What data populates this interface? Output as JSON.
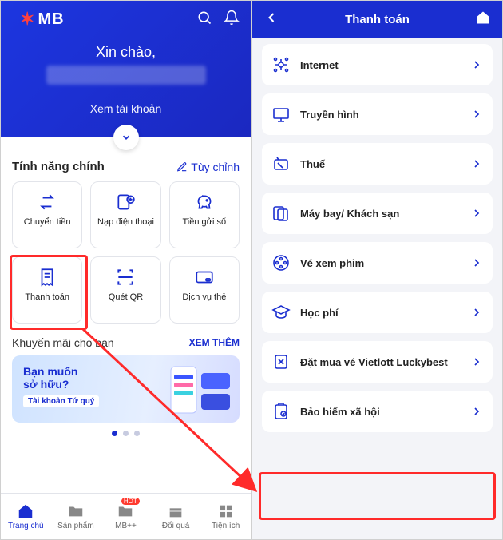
{
  "left": {
    "brand": "MB",
    "greeting": "Xin chào,",
    "view_account": "Xem tài khoản",
    "features_title": "Tính năng chính",
    "customize": "Tùy chỉnh",
    "tiles": [
      {
        "label": "Chuyển tiền"
      },
      {
        "label": "Nạp điện thoại"
      },
      {
        "label": "Tiền gửi số"
      },
      {
        "label": "Thanh toán"
      },
      {
        "label": "Quét QR"
      },
      {
        "label": "Dịch vụ thẻ"
      }
    ],
    "promo_title": "Khuyến mãi cho bạn",
    "see_more": "XEM THÊM",
    "banner": {
      "l1": "Bạn muốn",
      "l2": "sở hữu?",
      "tag": "Tài khoản Tứ quý"
    },
    "tabs": [
      {
        "label": "Trang chủ"
      },
      {
        "label": "Sản phẩm"
      },
      {
        "label": "MB++",
        "badge": "HOT"
      },
      {
        "label": "Đổi quà"
      },
      {
        "label": "Tiện ích"
      }
    ]
  },
  "right": {
    "title": "Thanh toán",
    "rows": [
      {
        "label": "Internet"
      },
      {
        "label": "Truyền hình"
      },
      {
        "label": "Thuế"
      },
      {
        "label": "Máy bay/ Khách sạn"
      },
      {
        "label": "Vé xem phim"
      },
      {
        "label": "Học phí"
      },
      {
        "label": "Đặt mua vé Vietlott Luckybest"
      },
      {
        "label": "Bảo hiểm xã hội"
      }
    ]
  }
}
